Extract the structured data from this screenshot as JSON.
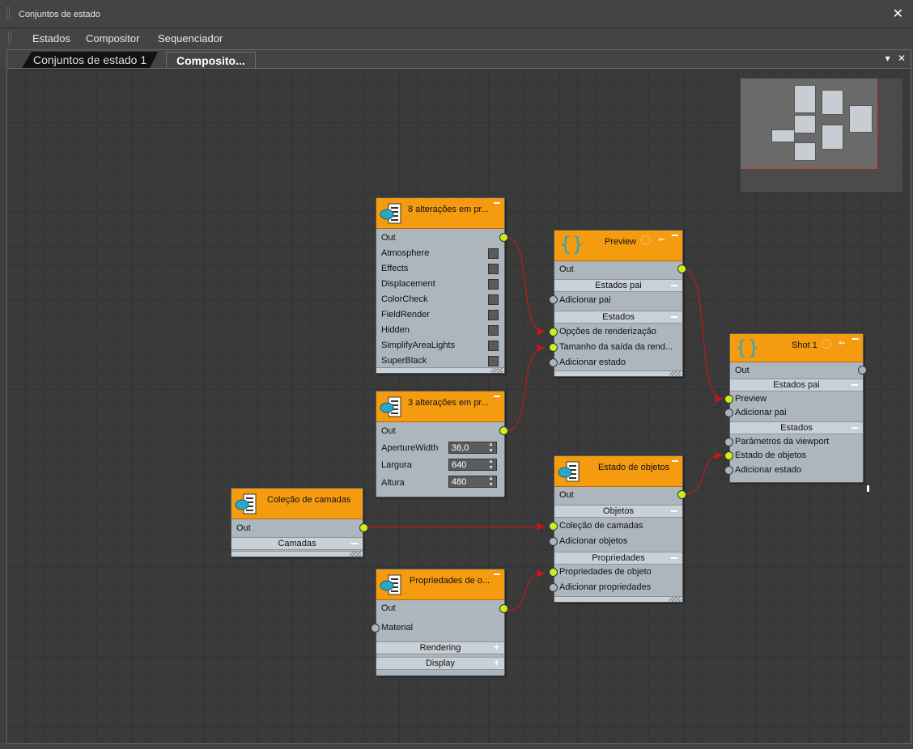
{
  "window": {
    "title": "Conjuntos de estado",
    "close_glyph": "✕"
  },
  "menu": [
    "Estados",
    "Compositor",
    "Sequenciador"
  ],
  "tabs": [
    "Conjuntos de estado 1",
    "Composito..."
  ],
  "tab_tools": {
    "dropdown_glyph": "▾",
    "close_glyph": "✕"
  },
  "nodes": {
    "render_changes": {
      "title": "8 alterações em pr...",
      "out": "Out",
      "options": [
        "Atmosphere",
        "Effects",
        "Displacement",
        "ColorCheck",
        "FieldRender",
        "Hidden",
        "SimplifyAreaLights",
        "SuperBlack"
      ]
    },
    "camera_changes": {
      "title": "3 alterações em pr...",
      "out": "Out",
      "params": [
        {
          "label": "ApertureWidth",
          "value": "36,0"
        },
        {
          "label": "Largura",
          "value": "640"
        },
        {
          "label": "Altura",
          "value": "480"
        }
      ]
    },
    "preview": {
      "title": "Preview",
      "out": "Out",
      "section_parents": "Estados pai",
      "add_parent": "Adicionar pai",
      "section_states": "Estados",
      "inputs": [
        "Opções de renderização",
        "Tamanho da saída da rend..."
      ],
      "add_state": "Adicionar estado"
    },
    "shot1": {
      "title": "Shot 1",
      "out": "Out",
      "section_parents": "Estados pai",
      "parent_inputs": [
        "Preview"
      ],
      "add_parent": "Adicionar pai",
      "section_states": "Estados",
      "state_inputs": [
        "Parâmetros da viewport",
        "Estado de objetos"
      ],
      "add_state": "Adicionar estado"
    },
    "layer_collection": {
      "title": "Coleção de camadas",
      "out": "Out",
      "section": "Camadas"
    },
    "object_state": {
      "title": "Estado de objetos",
      "out": "Out",
      "section_objects": "Objetos",
      "objects_inputs": [
        "Coleção de camadas"
      ],
      "add_objects": "Adicionar objetos",
      "section_props": "Propriedades",
      "props_inputs": [
        "Propriedades de objeto"
      ],
      "add_props": "Adicionar propriedades"
    },
    "object_props": {
      "title": "Propriedades de o...",
      "out": "Out",
      "material": "Material",
      "sections": [
        "Rendering",
        "Display"
      ]
    }
  },
  "colors": {
    "node_header": "#f59b0f",
    "node_body": "#adb5bd",
    "port_connected": "#c9f01c",
    "port_empty": "#aab4be",
    "wire": "#c01a1a",
    "canvas": "#3a3a3a"
  },
  "icons": {
    "state_set_icon": "clipboard-list-icon",
    "container_icon": "braces-icon"
  }
}
